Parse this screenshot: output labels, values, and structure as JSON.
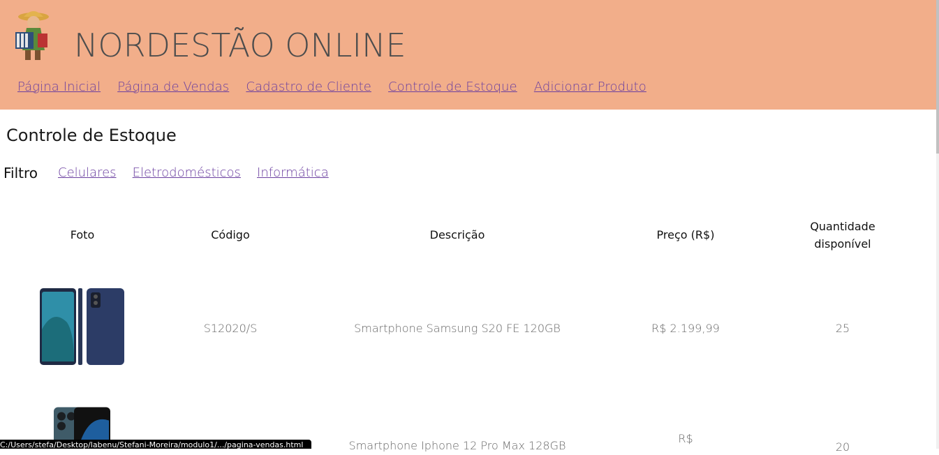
{
  "header": {
    "title": "NORDESTÃO ONLINE",
    "nav": [
      {
        "label": "Página Inicial"
      },
      {
        "label": "Página de Vendas"
      },
      {
        "label": "Cadastro de Cliente"
      },
      {
        "label": "Controle de Estoque"
      },
      {
        "label": "Adicionar Produto"
      }
    ]
  },
  "main": {
    "title": "Controle de Estoque",
    "filter_label": "Filtro",
    "filters": [
      "Celulares",
      "Eletrodomésticos",
      "Informática"
    ],
    "table": {
      "columns": [
        "Foto",
        "Código",
        "Descrição",
        "Preço (R$)",
        "Quantidade disponível"
      ],
      "rows": [
        {
          "code": "S12020/S",
          "description": "Smartphone Samsung S20 FE 120GB",
          "price": "R$ 2.199,99",
          "quantity": "25"
        },
        {
          "code": "",
          "description": "Smartphone Iphone 12 Pro Max 128GB",
          "price": "R$",
          "quantity": "20"
        }
      ]
    }
  },
  "status_bar": {
    "text": "C:/Users/stefa/Desktop/labenu/Stefani-Moreira/modulo1/.../pagina-vendas.html"
  },
  "colors": {
    "header_bg": "#f2ae8a",
    "link": "#6b3fa0"
  }
}
